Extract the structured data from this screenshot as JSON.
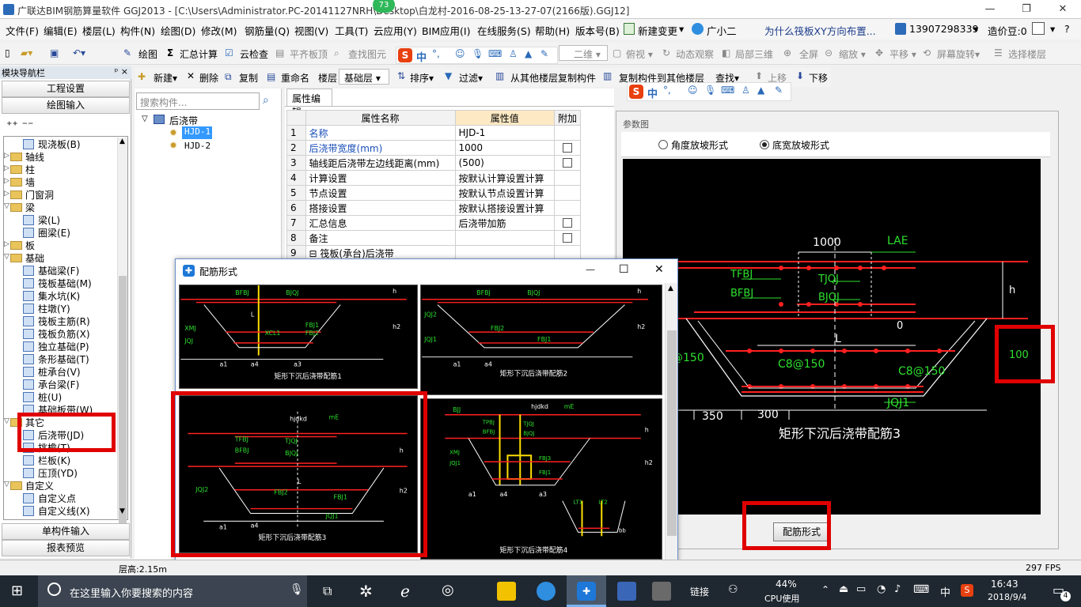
{
  "window": {
    "title": "广联达BIM钢筋算量软件 GGJ2013 - [C:\\Users\\Administrator.PC-20141127NRH\\Desktop\\白龙村-2016-08-25-13-27-07(2166版).GGJ12]",
    "badge": "73",
    "min": "—",
    "max": "❐",
    "close": "✕"
  },
  "menu": {
    "items": [
      "文件(F)",
      "编辑(E)",
      "楼层(L)",
      "构件(N)",
      "绘图(D)",
      "修改(M)",
      "钢筋量(Q)",
      "视图(V)",
      "工具(T)",
      "云应用(Y)",
      "BIM应用(I)",
      "在线服务(S)",
      "帮助(H)",
      "版本号(B)"
    ],
    "new_change": "新建变更",
    "guangxiaoer": "广小二",
    "question": "为什么筏板XY方向布置...",
    "phone": "13907298339",
    "price": "造价豆:0"
  },
  "toolbar1": {
    "draw": "绘图",
    "sum": "汇总计算",
    "cloud_check": "云检查",
    "flush_slab": "平齐板顶",
    "find_elem": "查找图元",
    "view_2d": "二维",
    "top_view": "俯视",
    "dynamic": "动态观察",
    "local_3d": "局部三维",
    "fullscreen": "全屏",
    "zoom": "缩放",
    "pan": "平移",
    "rotate": "屏幕旋转",
    "select_floor": "选择楼层"
  },
  "toolbar2": {
    "new": "新建",
    "delete": "删除",
    "copy": "复制",
    "rename": "重命名",
    "floor_label": "楼层",
    "floor_value": "基础层",
    "sort": "排序",
    "filter": "过滤",
    "copy_from": "从其他楼层复制构件",
    "copy_to": "复制构件到其他楼层",
    "find": "查找",
    "move_up": "上移",
    "move_down": "下移"
  },
  "ime": {
    "logo": "S",
    "zh": "中",
    "punct": "°,"
  },
  "nav": {
    "header": "模块导航栏",
    "pin": "ᵖ ×",
    "btn_project": "工程设置",
    "btn_draw": "绘图输入",
    "btn_single": "单构件输入",
    "btn_report": "报表预览",
    "tree": [
      {
        "label": "现浇板(B)",
        "level": 2,
        "kind": "item"
      },
      {
        "label": "轴线",
        "level": 1,
        "kind": "folder",
        "state": "collapsed"
      },
      {
        "label": "柱",
        "level": 1,
        "kind": "folder",
        "state": "collapsed"
      },
      {
        "label": "墙",
        "level": 1,
        "kind": "folder",
        "state": "collapsed"
      },
      {
        "label": "门窗洞",
        "level": 1,
        "kind": "folder",
        "state": "collapsed"
      },
      {
        "label": "梁",
        "level": 1,
        "kind": "folder",
        "state": "expanded"
      },
      {
        "label": "梁(L)",
        "level": 2,
        "kind": "item"
      },
      {
        "label": "圈梁(E)",
        "level": 2,
        "kind": "item"
      },
      {
        "label": "板",
        "level": 1,
        "kind": "folder",
        "state": "collapsed"
      },
      {
        "label": "基础",
        "level": 1,
        "kind": "folder",
        "state": "expanded"
      },
      {
        "label": "基础梁(F)",
        "level": 2,
        "kind": "item"
      },
      {
        "label": "筏板基础(M)",
        "level": 2,
        "kind": "item"
      },
      {
        "label": "集水坑(K)",
        "level": 2,
        "kind": "item"
      },
      {
        "label": "柱墩(Y)",
        "level": 2,
        "kind": "item"
      },
      {
        "label": "筏板主筋(R)",
        "level": 2,
        "kind": "item"
      },
      {
        "label": "筏板负筋(X)",
        "level": 2,
        "kind": "item"
      },
      {
        "label": "独立基础(P)",
        "level": 2,
        "kind": "item"
      },
      {
        "label": "条形基础(T)",
        "level": 2,
        "kind": "item"
      },
      {
        "label": "桩承台(V)",
        "level": 2,
        "kind": "item"
      },
      {
        "label": "承台梁(F)",
        "level": 2,
        "kind": "item"
      },
      {
        "label": "桩(U)",
        "level": 2,
        "kind": "item"
      },
      {
        "label": "基础板带(W)",
        "level": 2,
        "kind": "item"
      },
      {
        "label": "其它",
        "level": 1,
        "kind": "folder",
        "state": "expanded"
      },
      {
        "label": "后浇带(JD)",
        "level": 2,
        "kind": "item"
      },
      {
        "label": "挑檐(T)",
        "level": 2,
        "kind": "item"
      },
      {
        "label": "栏板(K)",
        "level": 2,
        "kind": "item"
      },
      {
        "label": "压顶(YD)",
        "level": 2,
        "kind": "item"
      },
      {
        "label": "自定义",
        "level": 1,
        "kind": "folder",
        "state": "expanded"
      },
      {
        "label": "自定义点",
        "level": 2,
        "kind": "item"
      },
      {
        "label": "自定义线(X)",
        "level": 2,
        "kind": "item"
      }
    ]
  },
  "components": {
    "search_placeholder": "搜索构件...",
    "root": "后浇带",
    "items": [
      "HJD-1",
      "HJD-2"
    ]
  },
  "properties": {
    "tab": "属性编辑",
    "col_name": "属性名称",
    "col_value": "属性值",
    "col_extra": "附加",
    "rows": [
      {
        "n": "1",
        "name": "名称",
        "value": "HJD-1",
        "blue": true,
        "check": false
      },
      {
        "n": "2",
        "name": "后浇带宽度(mm)",
        "value": "1000",
        "blue": true,
        "check": true
      },
      {
        "n": "3",
        "name": "轴线距后浇带左边线距离(mm)",
        "value": "(500)",
        "blue": false,
        "check": true
      },
      {
        "n": "4",
        "name": "计算设置",
        "value": "按默认计算设置计算",
        "blue": false,
        "check": false
      },
      {
        "n": "5",
        "name": "节点设置",
        "value": "按默认节点设置计算",
        "blue": false,
        "check": false
      },
      {
        "n": "6",
        "name": "搭接设置",
        "value": "按默认搭接设置计算",
        "blue": false,
        "check": false
      },
      {
        "n": "7",
        "name": "汇总信息",
        "value": "后浇带加筋",
        "blue": false,
        "check": true
      },
      {
        "n": "8",
        "name": "备注",
        "value": "",
        "blue": false,
        "check": true
      },
      {
        "n": "9",
        "name": "⊟ 筏板(承台)后浇带",
        "value": "",
        "blue": false,
        "check": false
      }
    ]
  },
  "param": {
    "title": "参数图",
    "radio1": "角度放坡形式",
    "radio2": "底宽放坡形式",
    "dims": {
      "w1000": "1000",
      "lae": "LAE",
      "h": "h",
      "tfbj": "TFBJ",
      "tjqj": "TJQJ",
      "bfbj": "BFBJ",
      "bjqj": "BJQJ",
      "zero": "0",
      "L": "L",
      "v100": "100",
      "c150": "@150",
      "c8a": "C8@150",
      "c8b": "C8@150",
      "jqj1": "JQJ1",
      "d350": "350",
      "d300": "300"
    },
    "caption": "矩形下沉后浇带配筋3",
    "button": "配筋形式"
  },
  "dialog": {
    "title": "配筋形式",
    "max": "☐",
    "close": "✕",
    "captions": [
      "矩形下沉后浇带配筋1",
      "矩形下沉后浇带配筋2",
      "矩形下沉后浇带配筋3",
      "矩形下沉后浇带配筋4"
    ],
    "labels": {
      "bfbj": "BFBJ",
      "bjqj": "BJQJ",
      "tfbj": "TFBJ",
      "tjqj": "TJQJ",
      "xmj": "XMJ",
      "jqj": "JQJ",
      "jqj1": "JQJ1",
      "jqj2": "JQJ2",
      "fbj1": "FBJ1",
      "fbj2": "FBJ2",
      "fbj3": "FBJ3",
      "h": "h",
      "h1": "h1",
      "h2": "h2",
      "a1": "a1",
      "a4": "a4",
      "a3": "a3",
      "L": "L",
      "hjdkd": "hjdkd",
      "me": "mE",
      "xcl": "XCL1",
      "bjj": "BJJ",
      "tpbj": "TPBJ",
      "lt1": "LT1",
      "lt2": "LT2",
      "bb": "bb"
    }
  },
  "status": {
    "floor_height": "层高:2.15m",
    "fps": "297 FPS"
  },
  "taskbar": {
    "search": "在这里输入你要搜索的内容",
    "link": "链接",
    "cpu_pct": "44%",
    "cpu_label": "CPU使用",
    "lang": "中",
    "time": "16:43",
    "date": "2018/9/4",
    "notif": "4"
  },
  "colors": {
    "highlight": "#e00000",
    "cad_red": "#ff2020",
    "cad_green": "#2ee02e",
    "cad_yellow": "#ffe000"
  }
}
